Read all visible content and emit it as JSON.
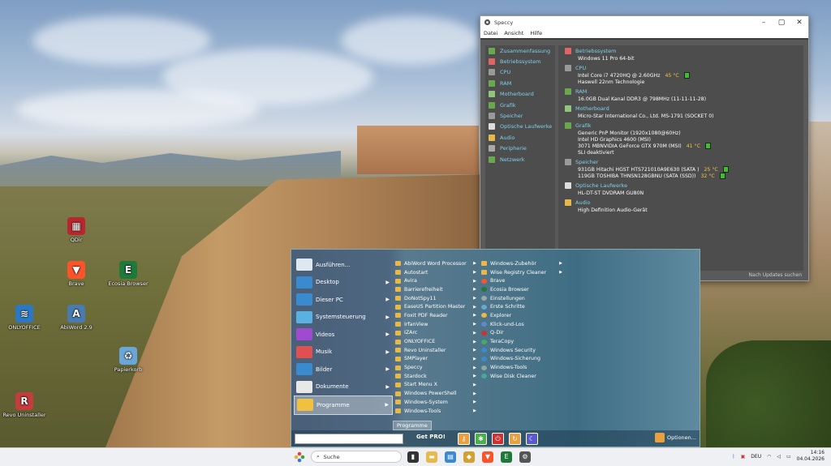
{
  "desktop": {
    "icons": [
      {
        "label": "QDir",
        "color": "#b8262e",
        "glyph": "▦"
      },
      {
        "label": "Brave",
        "color": "#fb542b",
        "glyph": "▼"
      },
      {
        "label": "Ecosia Browser",
        "color": "#1f7a3a",
        "glyph": "E"
      },
      {
        "label": "ONLYOFFICE",
        "color": "#2c78c4",
        "glyph": "≋"
      },
      {
        "label": "AbiWord 2.9",
        "color": "#4a7bb0",
        "glyph": "A"
      },
      {
        "label": "Papierkorb",
        "color": "#6aa7d8",
        "glyph": "♻"
      },
      {
        "label": "Revo Uninstaller",
        "color": "#c43d3d",
        "glyph": "R"
      }
    ]
  },
  "speccy": {
    "title": "Speccy",
    "menu": [
      "Datei",
      "Ansicht",
      "Hilfe"
    ],
    "nav": [
      {
        "label": "Zusammenfassung",
        "color": "#6aa84f"
      },
      {
        "label": "Betriebssystem",
        "color": "#e06666"
      },
      {
        "label": "CPU",
        "color": "#999999"
      },
      {
        "label": "RAM",
        "color": "#6aa84f"
      },
      {
        "label": "Motherboard",
        "color": "#93c47d"
      },
      {
        "label": "Grafik",
        "color": "#6aa84f"
      },
      {
        "label": "Speicher",
        "color": "#999999"
      },
      {
        "label": "Optische Laufwerke",
        "color": "#dddddd"
      },
      {
        "label": "Audio",
        "color": "#e6b84a"
      },
      {
        "label": "Peripherie",
        "color": "#aaaaaa"
      },
      {
        "label": "Netzwerk",
        "color": "#6aa84f"
      }
    ],
    "sections": [
      {
        "head": "Betriebssystem",
        "color": "#e06666",
        "lines": [
          {
            "text": "Windows 11 Pro 64-bit"
          }
        ]
      },
      {
        "head": "CPU",
        "color": "#999999",
        "lines": [
          {
            "text": "Intel Core i7 4720HQ @ 2.60GHz",
            "temp": "45 °C"
          },
          {
            "text": "Haswell 22nm Technologie"
          }
        ]
      },
      {
        "head": "RAM",
        "color": "#6aa84f",
        "lines": [
          {
            "text": "16.0GB Dual Kanal DDR3 @ 798MHz (11-11-11-28)"
          }
        ]
      },
      {
        "head": "Motherboard",
        "color": "#93c47d",
        "lines": [
          {
            "text": "Micro-Star International Co., Ltd. MS-1791 (SOCKET 0)"
          }
        ]
      },
      {
        "head": "Grafik",
        "color": "#6aa84f",
        "lines": [
          {
            "text": "Generic PnP Monitor (1920x1080@60Hz)"
          },
          {
            "text": "Intel HD Graphics 4600 (MSI)"
          },
          {
            "text": "3071 MBNVIDIA GeForce GTX 970M (MSI)",
            "temp": "41 °C"
          },
          {
            "text": "SLI deaktiviert"
          }
        ]
      },
      {
        "head": "Speicher",
        "color": "#999999",
        "lines": [
          {
            "text": "931GB Hitachi HGST HTS721010A9E630 (SATA )",
            "temp": "25 °C"
          },
          {
            "text": "119GB TOSHIBA THNSN128GBNU (SATA (SSD))",
            "temp": "32 °C"
          }
        ]
      },
      {
        "head": "Optische Laufwerke",
        "color": "#dddddd",
        "lines": [
          {
            "text": "HL-DT-ST DVDRAM GU80N"
          }
        ]
      },
      {
        "head": "Audio",
        "color": "#e6b84a",
        "lines": [
          {
            "text": "High Definition Audio-Gerät"
          }
        ]
      }
    ],
    "status": "Nach Updates suchen"
  },
  "startmenu": {
    "left": [
      {
        "label": "Ausführen...",
        "color": "#dfe8f0",
        "arrow": false
      },
      {
        "label": "Desktop",
        "color": "#3a8ad0",
        "arrow": true
      },
      {
        "label": "Dieser PC",
        "color": "#3a8ad0",
        "arrow": true
      },
      {
        "label": "Systemsteuerung",
        "color": "#5ab0e0",
        "arrow": true
      },
      {
        "label": "Videos",
        "color": "#a04ad0",
        "arrow": true
      },
      {
        "label": "Musik",
        "color": "#e05050",
        "arrow": true
      },
      {
        "label": "Bilder",
        "color": "#3a8ad0",
        "arrow": true
      },
      {
        "label": "Dokumente",
        "color": "#e8e8e8",
        "arrow": true
      },
      {
        "label": "Programme",
        "color": "#f0c040",
        "arrow": true,
        "active": true
      }
    ],
    "col1": [
      {
        "label": "AbiWord Word Processor",
        "arrow": true
      },
      {
        "label": "Autostart",
        "arrow": true
      },
      {
        "label": "Avira",
        "arrow": true
      },
      {
        "label": "Barrierefreiheit",
        "arrow": true
      },
      {
        "label": "DoNotSpy11",
        "arrow": true
      },
      {
        "label": "EaseUS Partition Master",
        "arrow": true
      },
      {
        "label": "Foxit PDF Reader",
        "arrow": true
      },
      {
        "label": "IrfanView",
        "arrow": true
      },
      {
        "label": "IZArc",
        "arrow": true
      },
      {
        "label": "ONLYOFFICE",
        "arrow": true
      },
      {
        "label": "Revo Uninstaller",
        "arrow": true
      },
      {
        "label": "SMPlayer",
        "arrow": true
      },
      {
        "label": "Speccy",
        "arrow": true
      },
      {
        "label": "Stardock",
        "arrow": true
      },
      {
        "label": "Start Menu X",
        "arrow": true
      },
      {
        "label": "Windows PowerShell",
        "arrow": true
      },
      {
        "label": "Windows-System",
        "arrow": true
      },
      {
        "label": "Windows-Tools",
        "arrow": true
      }
    ],
    "col2": [
      {
        "label": "Windows-Zubehör",
        "arrow": true,
        "folder": true
      },
      {
        "label": "Wise Registry Cleaner",
        "arrow": true,
        "folder": true
      },
      {
        "label": "Brave",
        "color": "#fb542b"
      },
      {
        "label": "Ecosia Browser",
        "color": "#1f7a3a"
      },
      {
        "label": "Einstellungen",
        "color": "#9aa"
      },
      {
        "label": "Erste Schritte",
        "color": "#6ac"
      },
      {
        "label": "Explorer",
        "color": "#e8b84a"
      },
      {
        "label": "Klick-und-Los",
        "color": "#5a8ad0"
      },
      {
        "label": "Q-Dir",
        "color": "#c33"
      },
      {
        "label": "TeraCopy",
        "color": "#4a6"
      },
      {
        "label": "Windows Security",
        "color": "#3a8ad0"
      },
      {
        "label": "Windows-Sicherung",
        "color": "#3a8ad0"
      },
      {
        "label": "Windows-Tools",
        "color": "#8aa"
      },
      {
        "label": "Wise Disk Cleaner",
        "color": "#4a9"
      }
    ],
    "programme_label": "Programme",
    "getpro": "Get PRO!",
    "buttons": [
      {
        "name": "key-icon",
        "glyph": "⚷",
        "color": "#e8a040"
      },
      {
        "name": "settings-icon",
        "glyph": "✱",
        "color": "#4ab04a"
      },
      {
        "name": "power-icon",
        "glyph": "⏻",
        "color": "#d03030"
      },
      {
        "name": "restart-icon",
        "glyph": "↻",
        "color": "#e8a040"
      },
      {
        "name": "sleep-icon",
        "glyph": "☾",
        "color": "#5a5ad0"
      }
    ],
    "optionen": "Optionen..."
  },
  "taskbar": {
    "search_placeholder": "Suche",
    "apps": [
      {
        "name": "taskview-icon",
        "color": "#333",
        "glyph": "▮"
      },
      {
        "name": "explorer-icon",
        "color": "#e8b84a",
        "glyph": "▬"
      },
      {
        "name": "calendar-icon",
        "color": "#3a8ad0",
        "glyph": "▤"
      },
      {
        "name": "app-icon",
        "color": "#d4a030",
        "glyph": "◆"
      },
      {
        "name": "brave-icon",
        "color": "#fb542b",
        "glyph": "▼"
      },
      {
        "name": "ecosia-icon",
        "color": "#1f7a3a",
        "glyph": "E"
      },
      {
        "name": "speccy-icon",
        "color": "#555",
        "glyph": "⚙"
      }
    ],
    "lang": "DEU",
    "time": "14:16",
    "date": "04.04.2026"
  }
}
